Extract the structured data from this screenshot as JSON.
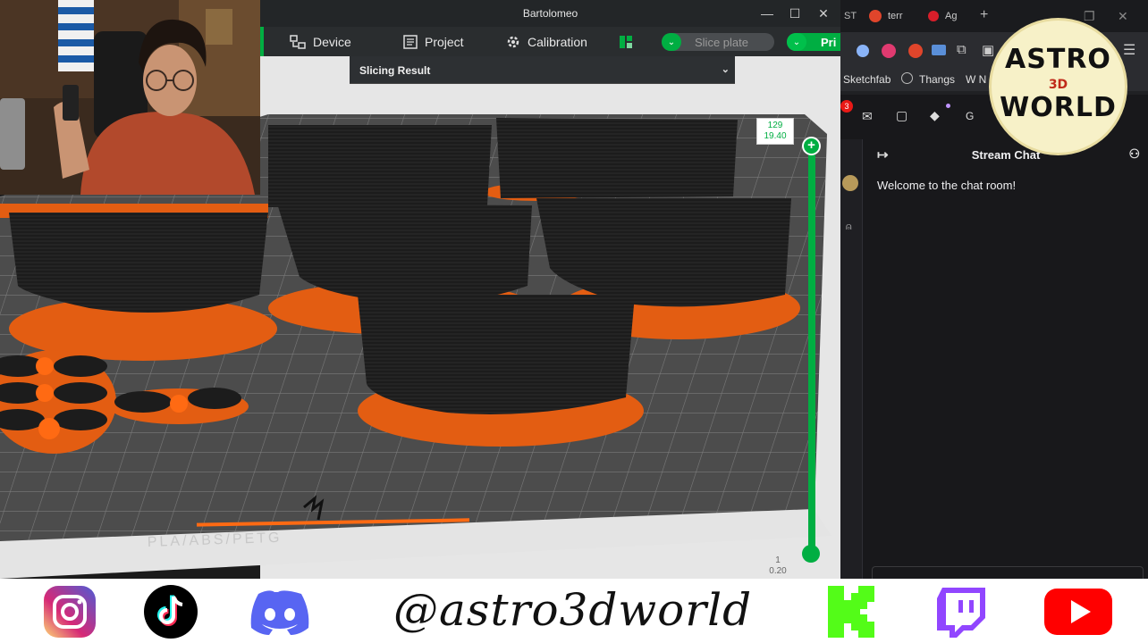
{
  "slicer": {
    "window_title": "Bartolomeo",
    "minimize": "—",
    "maximize": "☐",
    "close": "✕",
    "toolbar": {
      "device": "Device",
      "project": "Project",
      "calibration": "Calibration",
      "slice_plate": "Slice plate",
      "print": "Pri"
    },
    "slicing_result": "Slicing Result",
    "layer_slider": {
      "top_layer": "129",
      "top_height": "19.40",
      "bottom_layer": "1",
      "bottom_height": "0.20"
    },
    "plate_text": "PLA/ABS/PETG"
  },
  "browser": {
    "tabs": [
      "ST",
      "terr",
      "Ag",
      "+"
    ],
    "bookmarks": [
      "Sketchfab",
      "Thangs",
      "W N"
    ],
    "ext_badge": "3",
    "ext_label": "G",
    "chat_title": "Stream Chat",
    "chat_welcome": "Welcome to the chat room!"
  },
  "logo": {
    "line1": "ASTRO",
    "line2": "3D",
    "line3": "WORLD"
  },
  "footer": {
    "handle": "@astro3dworld",
    "icons": [
      "instagram-icon",
      "tiktok-icon",
      "discord-icon",
      "kick-icon",
      "twitch-icon",
      "youtube-icon"
    ]
  },
  "colors": {
    "bambu_green": "#00ae42",
    "support_orange": "#ff6a13",
    "filament_black": "#1c1c1c"
  }
}
